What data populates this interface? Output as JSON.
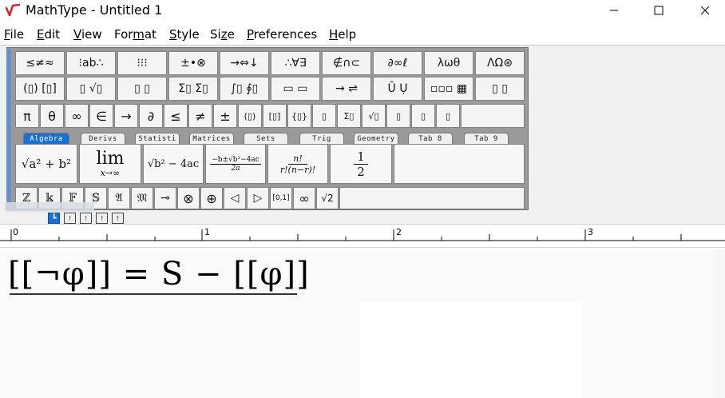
{
  "window": {
    "title": "MathType - Untitled 1"
  },
  "menu": [
    "File",
    "Edit",
    "View",
    "Format",
    "Style",
    "Size",
    "Preferences",
    "Help"
  ],
  "menu_mnemonic": [
    "F",
    "E",
    "V",
    "m",
    "S",
    "z",
    "P",
    "H"
  ],
  "symbol_row1": [
    "≤≠≈",
    "⁝ab∴",
    "⁝⁝⁝",
    "±•⊗",
    "→⇔↓",
    "∴∀∃",
    "∉∩⊂",
    "∂∞ℓ",
    "λωθ",
    "ΛΩ⊛"
  ],
  "symbol_row2": [
    "(▯) [▯]",
    "▯ √▯",
    "▯ ▯",
    "Σ▯ Σ▯",
    "∫▯ ∮▯",
    "▭ ▭",
    "→ ⇌",
    "Ū Ụ",
    "▫▫▫ ▦",
    "▯ ▯"
  ],
  "symbol_row3": [
    "π",
    "θ",
    "∞",
    "∈",
    "→",
    "∂",
    "≤",
    "≠",
    "±",
    "(▯)",
    "[▯]",
    "{▯}",
    "▯",
    "Σ▯",
    "√▯",
    "▯",
    "▯",
    "▯"
  ],
  "tabs": [
    "Algebra",
    "Derivs",
    "Statisti",
    "Matrices",
    "Sets",
    "Trig",
    "Geometry",
    "Tab 8",
    "Tab 9"
  ],
  "active_tab": "Algebra",
  "templates": {
    "sqrt_sum": "√a² + b²",
    "lim": "lim",
    "lim_sub": "x→∞",
    "sqrt_disc": "√b² − 4ac",
    "quadratic_num": "−b±√b²−4ac",
    "quadratic_den": "2a",
    "perm_num": "n!",
    "perm_den": "r!(n−r)!",
    "half_num": "1",
    "half_den": "2"
  },
  "symbol_row5": [
    "ℤ",
    "𝕜",
    "𝔽",
    "𝕊",
    "𝔄",
    "𝔐",
    "⊸",
    "⊗",
    "⊕",
    "◁",
    "▷",
    "[0,1]",
    "∞",
    "√2"
  ],
  "ruler": {
    "numbers": [
      "0",
      "1",
      "2",
      "3"
    ]
  },
  "equation": {
    "text": "[[¬φ]] = S − [[φ]]"
  }
}
